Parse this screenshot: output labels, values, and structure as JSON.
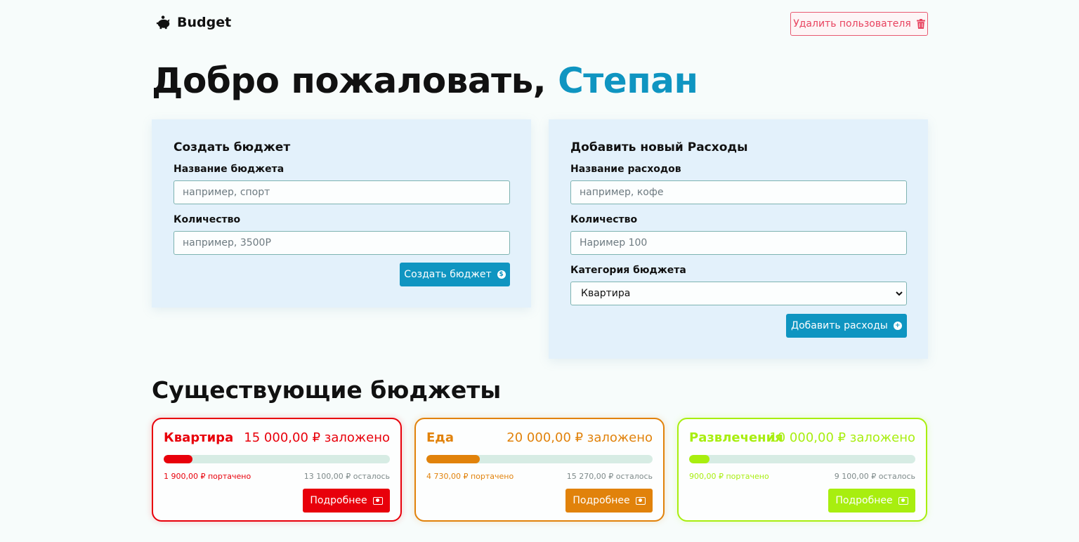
{
  "header": {
    "logo_text": "Budget",
    "delete_user_label": "Удалить пользователя"
  },
  "welcome": {
    "greeting": "Добро пожаловать,",
    "user_name": "Степан"
  },
  "create_budget": {
    "title": "Создать бюджет",
    "name_label": "Название бюджета",
    "name_placeholder": "например, спорт",
    "amount_label": "Количество",
    "amount_placeholder": "например, 3500Р",
    "submit_label": "Создать бюджет"
  },
  "add_expense": {
    "title": "Добавить новый Расходы",
    "name_label": "Название расходов",
    "name_placeholder": "например, кофе",
    "amount_label": "Количество",
    "amount_placeholder": "Наример 100",
    "category_label": "Категория бюджета",
    "category_selected": "Квартира",
    "submit_label": "Добавить расходы"
  },
  "existing": {
    "title": "Существующие бюджеты",
    "budgets": [
      {
        "name": "Квартира",
        "amount": "15 000,00 ₽ заложено",
        "spent": "1 900,00 ₽ портачено",
        "remaining": "13 100,00 ₽ осталось",
        "progress": 0.127,
        "color": "#e8000b",
        "more_label": "Подробнее"
      },
      {
        "name": "Еда",
        "amount": "20 000,00 ₽ заложено",
        "spent": "4 730,00 ₽ портачено",
        "remaining": "15 270,00 ₽ осталось",
        "progress": 0.2365,
        "color": "#e1820b",
        "more_label": "Подробнее"
      },
      {
        "name": "Развлечения",
        "amount": "10 000,00 ₽ заложено",
        "spent": "900,00 ₽ портачено",
        "remaining": "9 100,00 ₽ осталось",
        "progress": 0.09,
        "color": "#a8ee0f",
        "more_label": "Подробнее"
      }
    ]
  },
  "colors": {
    "accent": "#0f95c1",
    "danger": "#e8435f",
    "panel_bg": "#e3f1fb"
  }
}
